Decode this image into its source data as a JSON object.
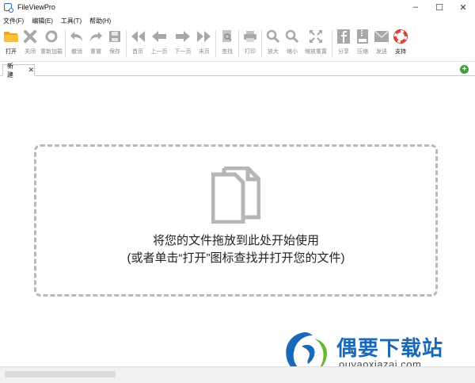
{
  "window": {
    "title": "FileViewPro",
    "controls": {
      "minimize": "–",
      "maximize": "☐",
      "close": "✕"
    }
  },
  "menu": [
    "文件(F)",
    "编辑(E)",
    "工具(T)",
    "帮助(H)"
  ],
  "toolbar": [
    {
      "label": "打开",
      "icon": "folder-open-icon",
      "enabled": true
    },
    {
      "label": "关闭",
      "icon": "close-x-icon",
      "enabled": false
    },
    {
      "label": "重新加载",
      "icon": "reload-icon",
      "enabled": false
    },
    {
      "label": "撤消",
      "icon": "undo-icon",
      "enabled": false
    },
    {
      "label": "重做",
      "icon": "redo-icon",
      "enabled": false
    },
    {
      "label": "保存",
      "icon": "save-icon",
      "enabled": false
    },
    {
      "label": "首页",
      "icon": "first-page-icon",
      "enabled": false
    },
    {
      "label": "上一页",
      "icon": "prev-page-icon",
      "enabled": false
    },
    {
      "label": "下一页",
      "icon": "next-page-icon",
      "enabled": false
    },
    {
      "label": "末页",
      "icon": "last-page-icon",
      "enabled": false
    },
    {
      "label": "查找",
      "icon": "find-icon",
      "enabled": false
    },
    {
      "label": "打印",
      "icon": "print-icon",
      "enabled": false
    },
    {
      "label": "放大",
      "icon": "zoom-in-icon",
      "enabled": false
    },
    {
      "label": "缩小",
      "icon": "zoom-out-icon",
      "enabled": false
    },
    {
      "label": "缩放重置",
      "icon": "zoom-reset-icon",
      "enabled": false
    },
    {
      "label": "分享",
      "icon": "facebook-share-icon",
      "enabled": false
    },
    {
      "label": "压缩",
      "icon": "zip-icon",
      "enabled": false
    },
    {
      "label": "发送",
      "icon": "mail-icon",
      "enabled": false
    },
    {
      "label": "支持",
      "icon": "lifebuoy-icon",
      "enabled": true
    }
  ],
  "tabs": [
    {
      "label": "新建",
      "close": "✕"
    }
  ],
  "add_tab": "+",
  "dropzone": {
    "line1": "将您的文件拖放到此处开始使用",
    "line2": "(或者单击“打开”图标查找并打开您的文件)"
  },
  "watermark": {
    "title": "偶要下载站",
    "url": "ouyaoxiazai.com"
  },
  "colors": {
    "accent": "#f0a51f",
    "disabled_icon": "#a8a8a8",
    "watermark_blue": "#1a68b8",
    "support_red": "#e5432f"
  }
}
